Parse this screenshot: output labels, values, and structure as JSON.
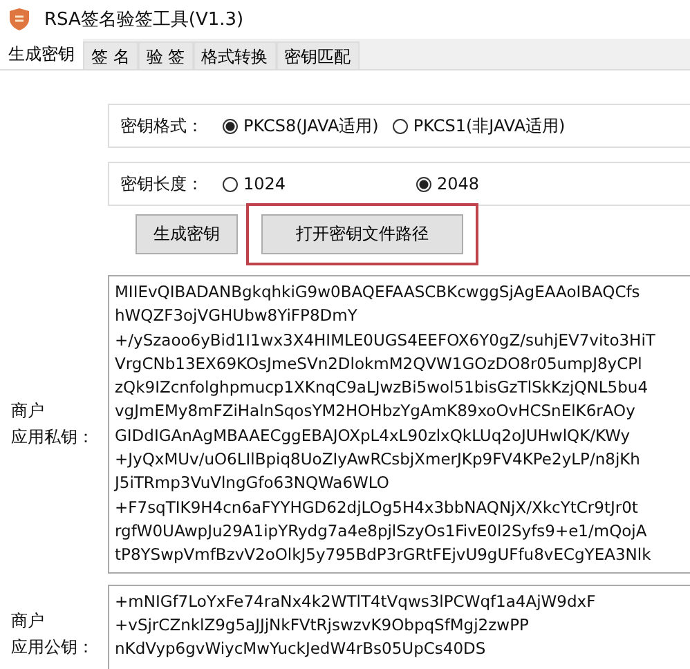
{
  "window": {
    "title": "RSA签名验签工具(V1.3)"
  },
  "tabs": [
    {
      "label": "生成密钥",
      "selected": true
    },
    {
      "label": "签 名",
      "selected": false
    },
    {
      "label": "验 签",
      "selected": false
    },
    {
      "label": "格式转换",
      "selected": false
    },
    {
      "label": "密钥匹配",
      "selected": false
    }
  ],
  "key_format": {
    "label": "密钥格式：",
    "options": [
      {
        "label": "PKCS8(JAVA适用)",
        "selected": true
      },
      {
        "label": "PKCS1(非JAVA适用)",
        "selected": false
      }
    ]
  },
  "key_length": {
    "label": "密钥长度：",
    "options": [
      {
        "label": "1024",
        "selected": false
      },
      {
        "label": "2048",
        "selected": true
      }
    ]
  },
  "buttons": [
    {
      "label": "生成密钥",
      "highlighted": false
    },
    {
      "label": "打开密钥文件路径",
      "highlighted": true
    }
  ],
  "private_key": {
    "label_lines": [
      "商户",
      "应用私钥："
    ],
    "lines": [
      "MIIEvQIBADANBgkqhkiG9w0BAQEFAASCBKcwggSjAgEAAoIBAQCfs",
      "hWQZF3ojVGHUbw8YiFP8DmY",
      "+/ySzaoo6yBid1I1wx3X4HIMLE0UGS4EEFOX6Y0gZ/suhjEV7vito3HiT",
      "VrgCNb13EX69KOsJmeSVn2DlokmM2QVW1GOzDO8r05umpJ8yCPl",
      "zQk9IZcnfolghpmucp1XKnqC9aLJwzBi5wol51bisGzTlSkKzjQNL5bu4",
      "vgJmEMy8mFZiHalnSqosYM2HOHbzYgAmK89xoOvHCSnElK6rAOy",
      "GIDdIGAnAgMBAAECggEBAJOXpL4xL90zlxQkLUq2oJUHwlQK/KWy",
      "+JyQxMUv/uO6LIlBpiq8UoZIyAwRCsbjXmerJKp9FV4KPe2yLP/n8jKh",
      "J5iTRmp3VuVlngGfo63NQWa6WLO",
      "+F7sqTIK9H4cn6aFYYHGD62djLOg5H4x3bbNAQNjX/XkcYtCr9tJr0t",
      "rgfW0UAwpJu29A1ipYRydg7a4e8pjlSzyOs1FivE0l2Syfs9+e1/mQojA",
      "tP8YSwpVmfBzvV2oOlkJ5y795BdP3rGRtFEjvU9gUFfu8vECgYEA3Nlk"
    ]
  },
  "public_key": {
    "label_lines": [
      "商户",
      "应用公钥："
    ],
    "lines": [
      "+mNIGf7LoYxFe74raNx4k2WTlT4tVqws3lPCWqf1a4AjW9dxF",
      "+vSjrCZnklZ9g5aJJjNkFVtRjswzvK9ObpqSfMgj2zwPP",
      "nKdVyp6gvWiycMwYuckJedW4rBs05UpCs40DS"
    ]
  }
}
